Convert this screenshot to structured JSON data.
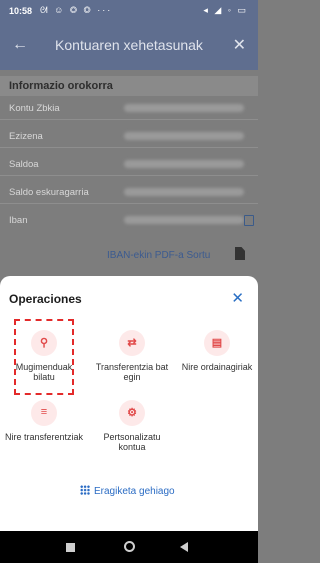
{
  "status_bar": {
    "time": "10:58",
    "left_icons": "ᘛ ☺ ◎ ◎ ···",
    "right_icons": "◂ ◢ ◦ ▭"
  },
  "header": {
    "title": "Kontuaren xehetasunak"
  },
  "account_info": {
    "section_title": "Informazio orokorra",
    "rows": [
      {
        "label": "Kontu Zbkia"
      },
      {
        "label": "Ezizena"
      },
      {
        "label": "Saldoa"
      },
      {
        "label": "Saldo eskuragarria"
      },
      {
        "label": "Iban"
      }
    ],
    "pdf_link": "IBAN-ekin PDF-a Sortu"
  },
  "operations": {
    "title": "Operaciones",
    "items": [
      {
        "label": "Mugimenduak bilatu",
        "icon": "search-icon"
      },
      {
        "label": "Transferentzia bat egin",
        "icon": "transfer-icon"
      },
      {
        "label": "Nire ordainagiriak",
        "icon": "receipt-icon"
      },
      {
        "label": "Nire transferentziak",
        "icon": "list-icon"
      },
      {
        "label": "Pertsonalizatu kontua",
        "icon": "settings-icon"
      }
    ],
    "more": "Eragiketa gehiago"
  },
  "colors": {
    "accent": "#2b6cc4",
    "icon_red": "#e14a4a",
    "highlight": "#e32a2a"
  }
}
